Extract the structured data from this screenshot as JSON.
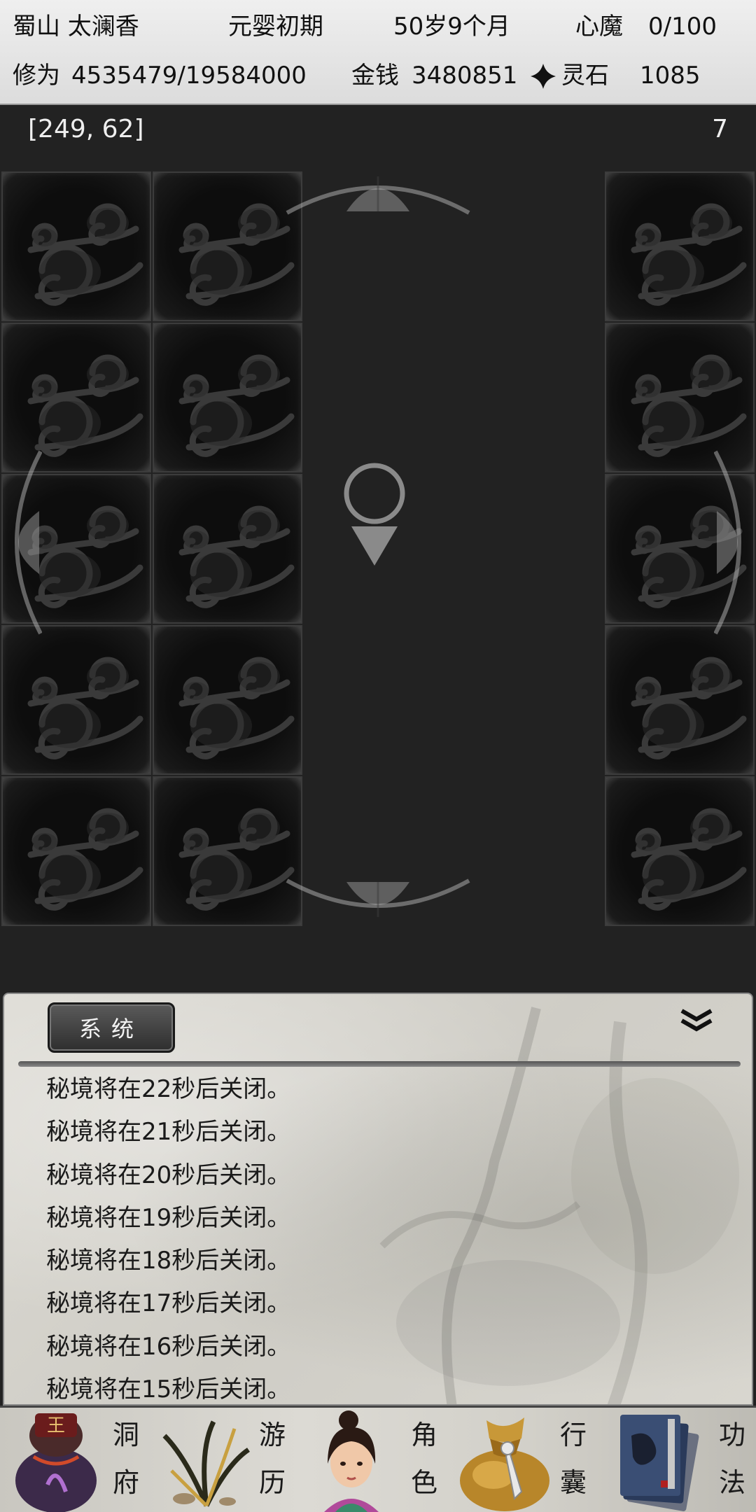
{
  "status": {
    "sect_and_name": "蜀山 太澜香",
    "realm": "元婴初期",
    "age": "50岁9个月",
    "heart_demon_label": "心魔",
    "heart_demon_value": "0/100",
    "cultivation_label": "修为",
    "cultivation_value": "4535479/19584000",
    "money_label": "金钱",
    "money_value": "3480851",
    "spirit_stone_label": "灵石",
    "spirit_stone_value": "1085"
  },
  "map": {
    "coordinates": "[249, 62]",
    "step_count": "7"
  },
  "log": {
    "tab_label": "系统",
    "messages": [
      "秘境将在22秒后关闭。",
      "秘境将在21秒后关闭。",
      "秘境将在20秒后关闭。",
      "秘境将在19秒后关闭。",
      "秘境将在18秒后关闭。",
      "秘境将在17秒后关闭。",
      "秘境将在16秒后关闭。",
      "秘境将在15秒后关闭。"
    ]
  },
  "nav": {
    "cave": {
      "top": "洞",
      "bottom": "府",
      "emblem_char": "王"
    },
    "travel": {
      "top": "游",
      "bottom": "历"
    },
    "character": {
      "top": "角",
      "bottom": "色"
    },
    "bag": {
      "top": "行",
      "bottom": "囊"
    },
    "skills": {
      "top": "功",
      "bottom": "法"
    }
  },
  "colors": {
    "map_bg": "#222222",
    "tile_bg": "#0d0d0d",
    "status_bg": "#e6e6e6",
    "log_bg": "#d6d4cd",
    "tab_bg": "#3a3a3a"
  },
  "icons": [
    "cloud-fog-icon",
    "player-location-icon",
    "move-up-arrow-icon",
    "move-down-arrow-icon",
    "move-left-arrow-icon",
    "move-right-arrow-icon",
    "spirit-stone-icon",
    "collapse-chevron-icon"
  ]
}
